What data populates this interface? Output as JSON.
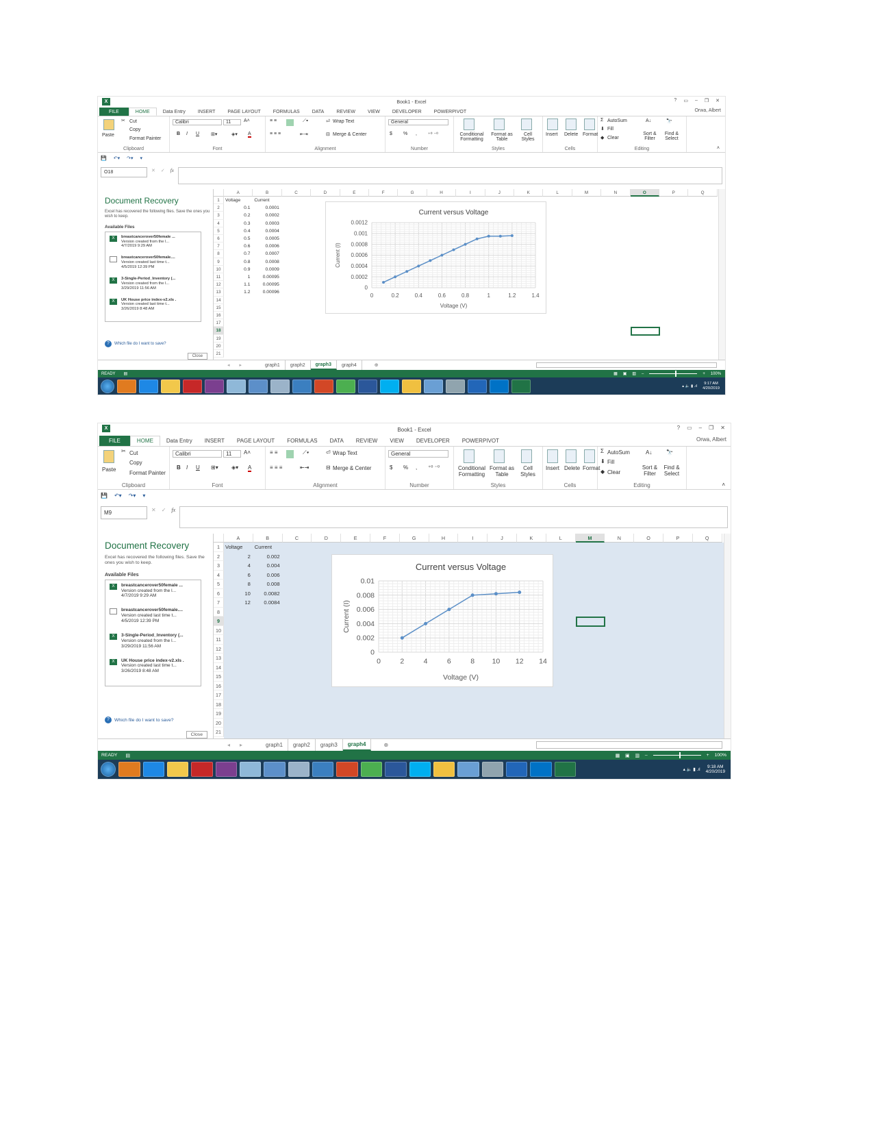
{
  "ribbon": {
    "tabs": [
      "FILE",
      "HOME",
      "Data Entry",
      "INSERT",
      "PAGE LAYOUT",
      "FORMULAS",
      "DATA",
      "REVIEW",
      "VIEW",
      "DEVELOPER",
      "POWERPIVOT"
    ],
    "active_tab": "HOME",
    "clipboard": {
      "label": "Clipboard",
      "paste": "Paste",
      "cut": "Cut",
      "copy": "Copy",
      "format_painter": "Format Painter"
    },
    "font": {
      "label": "Font",
      "family": "Calibri",
      "size": "11",
      "bold": "B",
      "italic": "I",
      "underline": "U"
    },
    "alignment": {
      "label": "Alignment",
      "wrap_text": "Wrap Text",
      "merge_center": "Merge & Center"
    },
    "number": {
      "label": "Number",
      "format": "General",
      "currency": "$",
      "percent": "%",
      "comma": ","
    },
    "styles": {
      "label": "Styles",
      "conditional": "Conditional Formatting",
      "format_table": "Format as Table",
      "cell_styles": "Cell Styles"
    },
    "cells": {
      "label": "Cells",
      "insert": "Insert",
      "delete": "Delete",
      "format": "Format"
    },
    "editing": {
      "label": "Editing",
      "autosum": "AutoSum",
      "fill": "Fill",
      "clear": "Clear",
      "sort_filter": "Sort & Filter",
      "find_select": "Find & Select"
    }
  },
  "recovery": {
    "title": "Document Recovery",
    "description": "Excel has recovered the following files. Save the ones you wish to keep.",
    "available": "Available Files",
    "files": [
      {
        "name": "breastcancerover50female ...",
        "detail": "Version created from the l...",
        "date": "4/7/2019 9:29 AM",
        "icon": "excel"
      },
      {
        "name": "breastcancerover50female....",
        "detail": "Version created last time t...",
        "date": "4/5/2019 12:39 PM",
        "icon": "blank"
      },
      {
        "name": "3-Single-Period_Inventory (...",
        "detail": "Version created from the l...",
        "date": "3/29/2019 11:56 AM",
        "icon": "excel"
      },
      {
        "name": "UK House price index-v2.xls .",
        "detail": "Version created last time t...",
        "date": "3/26/2019 8:48 AM",
        "icon": "excel"
      }
    ],
    "help": "Which file do I want to save?",
    "close": "Close"
  },
  "columns": [
    "A",
    "B",
    "C",
    "D",
    "E",
    "F",
    "G",
    "H",
    "I",
    "J",
    "K",
    "L",
    "M",
    "N",
    "O",
    "P",
    "Q"
  ],
  "taskbar_apps": [
    {
      "name": "start",
      "color": "#2a7fd0"
    },
    {
      "name": "media-player",
      "color": "#e07b20"
    },
    {
      "name": "internet-explorer",
      "color": "#1e88e5"
    },
    {
      "name": "sticky-notes",
      "color": "#f2c84b"
    },
    {
      "name": "video",
      "color": "#c62828"
    },
    {
      "name": "winrar",
      "color": "#7b3f8f"
    },
    {
      "name": "app",
      "color": "#8fb8d8"
    },
    {
      "name": "network",
      "color": "#5c8fc9"
    },
    {
      "name": "calculator",
      "color": "#9bb3c9"
    },
    {
      "name": "remote-desktop",
      "color": "#3b7fc0"
    },
    {
      "name": "powerpoint",
      "color": "#d24726"
    },
    {
      "name": "chrome",
      "color": "#4caf50"
    },
    {
      "name": "word",
      "color": "#2b579a"
    },
    {
      "name": "skype",
      "color": "#00aff0"
    },
    {
      "name": "file-explorer",
      "color": "#f0c040"
    },
    {
      "name": "display",
      "color": "#6a9fd4"
    },
    {
      "name": "notepad",
      "color": "#90a4ae"
    },
    {
      "name": "r",
      "color": "#2266b8"
    },
    {
      "name": "outlook",
      "color": "#0072c6"
    },
    {
      "name": "excel",
      "color": "#217346"
    }
  ],
  "windows": [
    {
      "title": "Book1 - Excel",
      "user": "Orwa, Albert",
      "help": "?",
      "name_box": "O18",
      "fx": "fx",
      "rows": [
        "1",
        "2",
        "3",
        "4",
        "5",
        "6",
        "7",
        "8",
        "9",
        "10",
        "11",
        "12",
        "13",
        "14",
        "15",
        "16",
        "17",
        "18",
        "19",
        "20",
        "21"
      ],
      "cells": [
        [
          "Voltage",
          "Current"
        ],
        [
          "0.1",
          "0.0001"
        ],
        [
          "0.2",
          "0.0002"
        ],
        [
          "0.3",
          "0.0003"
        ],
        [
          "0.4",
          "0.0004"
        ],
        [
          "0.5",
          "0.0005"
        ],
        [
          "0.6",
          "0.0006"
        ],
        [
          "0.7",
          "0.0007"
        ],
        [
          "0.8",
          "0.0008"
        ],
        [
          "0.9",
          "0.0009"
        ],
        [
          "1",
          "0.00095"
        ],
        [
          "1.1",
          "0.00095"
        ],
        [
          "1.2",
          "0.00096"
        ]
      ],
      "selected_cell": {
        "col": "O",
        "row": "18"
      },
      "sheet_selected_all": false,
      "sheet_tabs": [
        "graph1",
        "graph2",
        "graph3",
        "graph4"
      ],
      "active_sheet": "graph3",
      "status": "READY",
      "zoom": "100%",
      "clock": {
        "time": "9:17 AM",
        "date": "4/20/2019"
      }
    },
    {
      "title": "Book1 - Excel",
      "user": "Orwa, Albert",
      "help": "?",
      "name_box": "M9",
      "fx": "fx",
      "rows": [
        "1",
        "2",
        "3",
        "4",
        "5",
        "6",
        "7",
        "8",
        "9",
        "10",
        "11",
        "12",
        "13",
        "14",
        "15",
        "16",
        "17",
        "18",
        "19",
        "20",
        "21"
      ],
      "cells": [
        [
          "Voltage",
          "Current"
        ],
        [
          "2",
          "0.002"
        ],
        [
          "4",
          "0.004"
        ],
        [
          "6",
          "0.006"
        ],
        [
          "8",
          "0.008"
        ],
        [
          "10",
          "0.0082"
        ],
        [
          "12",
          "0.0084"
        ]
      ],
      "selected_cell": {
        "col": "M",
        "row": "9"
      },
      "sheet_selected_all": true,
      "sheet_tabs": [
        "graph1",
        "graph2",
        "graph3",
        "graph4"
      ],
      "active_sheet": "graph4",
      "status": "READY",
      "zoom": "100%",
      "clock": {
        "time": "9:18 AM",
        "date": "4/20/2019"
      }
    }
  ],
  "chart_data": [
    {
      "type": "line",
      "title": "Current versus Voltage",
      "xlabel": "Voltage (V)",
      "ylabel": "Current (I)",
      "x": [
        0.1,
        0.2,
        0.3,
        0.4,
        0.5,
        0.6,
        0.7,
        0.8,
        0.9,
        1,
        1.1,
        1.2
      ],
      "y": [
        0.0001,
        0.0002,
        0.0003,
        0.0004,
        0.0005,
        0.0006,
        0.0007,
        0.0008,
        0.0009,
        0.00095,
        0.00095,
        0.00096
      ],
      "xlim": [
        0,
        1.4
      ],
      "xstep": 0.2,
      "ylim": [
        0,
        0.0012
      ],
      "ystep": 0.0002,
      "xticks": [
        "0",
        "0.2",
        "0.4",
        "0.6",
        "0.8",
        "1",
        "1.2",
        "1.4"
      ],
      "yticks": [
        "0",
        "0.0002",
        "0.0004",
        "0.0006",
        "0.0008",
        "0.001",
        "0.0012"
      ],
      "grid": true,
      "minor_grid": true,
      "color": "#5b8fc7"
    },
    {
      "type": "line",
      "title": "Current versus Voltage",
      "xlabel": "Voltage (V)",
      "ylabel": "Current (I)",
      "x": [
        2,
        4,
        6,
        8,
        10,
        12
      ],
      "y": [
        0.002,
        0.004,
        0.006,
        0.008,
        0.0082,
        0.0084
      ],
      "xlim": [
        0,
        14
      ],
      "xstep": 2,
      "ylim": [
        0,
        0.01
      ],
      "ystep": 0.002,
      "xticks": [
        "0",
        "2",
        "4",
        "6",
        "8",
        "10",
        "12",
        "14"
      ],
      "yticks": [
        "0",
        "0.002",
        "0.004",
        "0.006",
        "0.008",
        "0.01"
      ],
      "grid": true,
      "minor_grid": true,
      "color": "#5b8fc7"
    }
  ]
}
